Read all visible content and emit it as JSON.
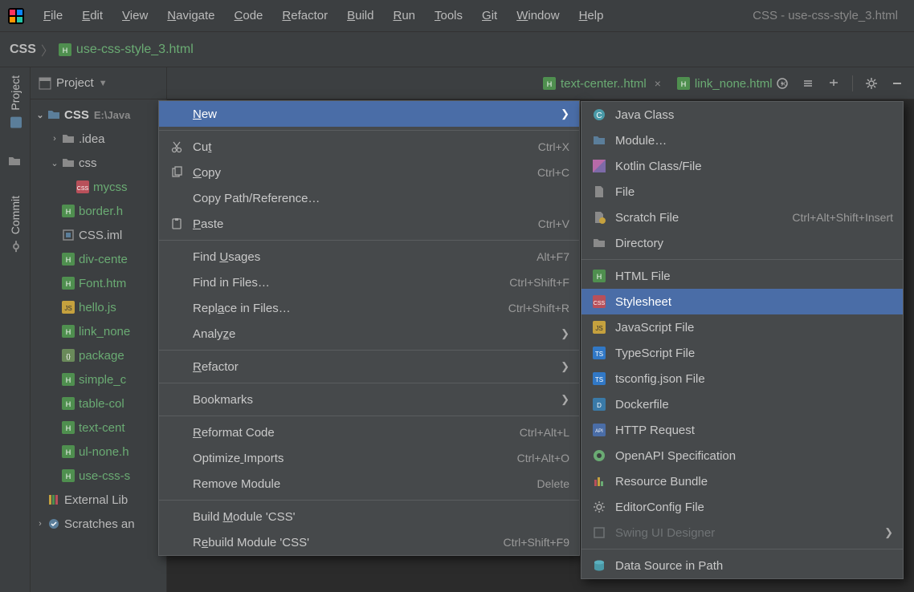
{
  "window_title": "CSS - use-css-style_3.html",
  "menubar": [
    "File",
    "Edit",
    "View",
    "Navigate",
    "Code",
    "Refactor",
    "Build",
    "Run",
    "Tools",
    "Git",
    "Window",
    "Help"
  ],
  "breadcrumbs": {
    "root": "CSS",
    "file": "use-css-style_3.html"
  },
  "gutter": {
    "project": "Project",
    "commit": "Commit"
  },
  "project_panel": {
    "title": "Project"
  },
  "tree": [
    {
      "depth": 0,
      "expander": "v",
      "label": "CSS",
      "path": "E:\\Java",
      "bold": true,
      "icon": "folder-root"
    },
    {
      "depth": 1,
      "expander": ">",
      "label": ".idea",
      "icon": "folder"
    },
    {
      "depth": 1,
      "expander": "v",
      "label": "css",
      "icon": "folder"
    },
    {
      "depth": 2,
      "expander": "",
      "label": "mycss",
      "green": true,
      "icon": "css"
    },
    {
      "depth": 1,
      "expander": "",
      "label": "border.h",
      "green": true,
      "icon": "html"
    },
    {
      "depth": 1,
      "expander": "",
      "label": "CSS.iml",
      "icon": "iml"
    },
    {
      "depth": 1,
      "expander": "",
      "label": "div-cente",
      "green": true,
      "icon": "html"
    },
    {
      "depth": 1,
      "expander": "",
      "label": "Font.htm",
      "green": true,
      "icon": "html"
    },
    {
      "depth": 1,
      "expander": "",
      "label": "hello.js",
      "green": true,
      "icon": "js"
    },
    {
      "depth": 1,
      "expander": "",
      "label": "link_none",
      "green": true,
      "icon": "html"
    },
    {
      "depth": 1,
      "expander": "",
      "label": "package",
      "green": true,
      "icon": "json"
    },
    {
      "depth": 1,
      "expander": "",
      "label": "simple_c",
      "green": true,
      "icon": "html"
    },
    {
      "depth": 1,
      "expander": "",
      "label": "table-col",
      "green": true,
      "icon": "html"
    },
    {
      "depth": 1,
      "expander": "",
      "label": "text-cent",
      "green": true,
      "icon": "html"
    },
    {
      "depth": 1,
      "expander": "",
      "label": "ul-none.h",
      "green": true,
      "icon": "html"
    },
    {
      "depth": 1,
      "expander": "",
      "label": "use-css-s",
      "green": true,
      "icon": "html"
    },
    {
      "depth": 0,
      "expander": "",
      "label": "External Lib",
      "icon": "lib"
    },
    {
      "depth": 0,
      "expander": ">",
      "label": "Scratches an",
      "icon": "scratch"
    }
  ],
  "editor_tabs": [
    {
      "label": "text-center..html"
    },
    {
      "label": "link_none.html"
    }
  ],
  "context_menu": [
    {
      "label": "New",
      "u": 0,
      "selected": true,
      "arrow": true
    },
    {
      "sep": true
    },
    {
      "label": "Cut",
      "u": 2,
      "icon": "cut",
      "shortcut": "Ctrl+X"
    },
    {
      "label": "Copy",
      "u": 0,
      "icon": "copy",
      "shortcut": "Ctrl+C"
    },
    {
      "label": "Copy Path/Reference…"
    },
    {
      "label": "Paste",
      "u": 0,
      "icon": "paste",
      "shortcut": "Ctrl+V"
    },
    {
      "sep": true
    },
    {
      "label": "Find Usages",
      "u": 5,
      "shortcut": "Alt+F7"
    },
    {
      "label": "Find in Files…",
      "shortcut": "Ctrl+Shift+F"
    },
    {
      "label": "Replace in Files…",
      "u": 4,
      "shortcut": "Ctrl+Shift+R"
    },
    {
      "label": "Analyze",
      "u": 5,
      "arrow": true
    },
    {
      "sep": true
    },
    {
      "label": "Refactor",
      "u": 0,
      "arrow": true
    },
    {
      "sep": true
    },
    {
      "label": "Bookmarks",
      "arrow": true
    },
    {
      "sep": true
    },
    {
      "label": "Reformat Code",
      "u": 0,
      "shortcut": "Ctrl+Alt+L"
    },
    {
      "label": "Optimize Imports",
      "u": 8,
      "shortcut": "Ctrl+Alt+O"
    },
    {
      "label": "Remove Module",
      "shortcut": "Delete"
    },
    {
      "sep": true
    },
    {
      "label": "Build Module 'CSS'",
      "u": 6
    },
    {
      "label": "Rebuild Module 'CSS'",
      "u": 1,
      "shortcut": "Ctrl+Shift+F9"
    }
  ],
  "new_submenu": [
    {
      "label": "Java Class",
      "icon": "class-c"
    },
    {
      "label": "Module…",
      "icon": "folder-blue"
    },
    {
      "label": "Kotlin Class/File",
      "icon": "kotlin"
    },
    {
      "label": "File",
      "icon": "file"
    },
    {
      "label": "Scratch File",
      "icon": "scratch-file",
      "shortcut": "Ctrl+Alt+Shift+Insert"
    },
    {
      "label": "Directory",
      "icon": "folder"
    },
    {
      "sep": true
    },
    {
      "label": "HTML File",
      "icon": "html"
    },
    {
      "label": "Stylesheet",
      "icon": "css",
      "selected": true
    },
    {
      "label": "JavaScript File",
      "icon": "js"
    },
    {
      "label": "TypeScript File",
      "icon": "ts"
    },
    {
      "label": "tsconfig.json File",
      "icon": "ts"
    },
    {
      "label": "Dockerfile",
      "icon": "docker"
    },
    {
      "label": "HTTP Request",
      "icon": "http"
    },
    {
      "label": "OpenAPI Specification",
      "icon": "openapi"
    },
    {
      "label": "Resource Bundle",
      "icon": "bundle"
    },
    {
      "label": "EditorConfig File",
      "icon": "gear"
    },
    {
      "label": "Swing UI Designer",
      "icon": "swing",
      "disabled": true,
      "arrow": true
    },
    {
      "sep": true
    },
    {
      "label": "Data Source in Path",
      "icon": "database"
    }
  ]
}
